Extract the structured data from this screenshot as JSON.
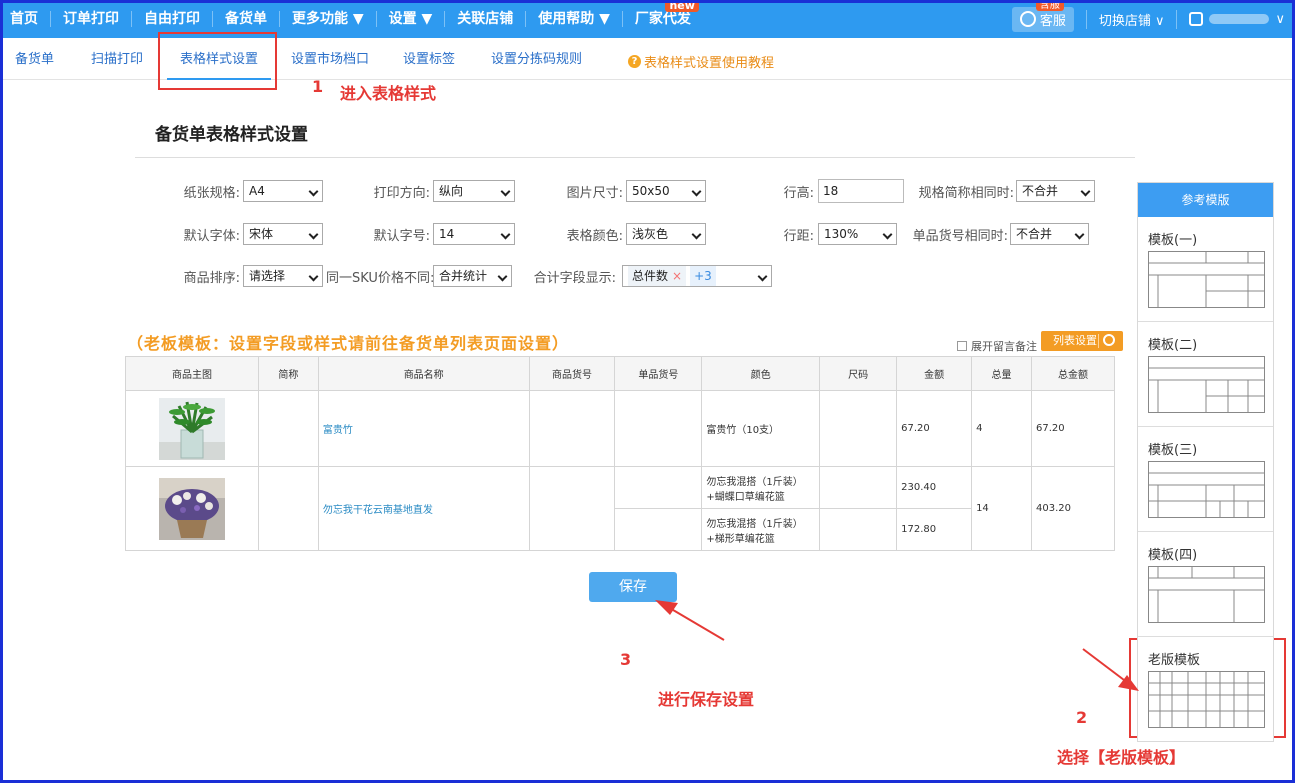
{
  "topnav": {
    "items": [
      {
        "label": "首页"
      },
      {
        "label": "订单打印"
      },
      {
        "label": "自由打印"
      },
      {
        "label": "备货单"
      },
      {
        "label": "更多功能 ▼"
      },
      {
        "label": "设置 ▼"
      },
      {
        "label": "关联店铺"
      },
      {
        "label": "使用帮助 ▼"
      },
      {
        "label": "厂家代发",
        "badge": "new"
      }
    ],
    "kefu": "客服",
    "kefu_badge": "含服",
    "switch_shop": "切换店铺 ∨"
  },
  "subnav": {
    "tabs": [
      "备货单",
      "扫描打印",
      "表格样式设置",
      "设置市场档口",
      "设置标签",
      "设置分拣码规则"
    ],
    "help": "表格样式设置使用教程",
    "help_icon": "?"
  },
  "annotations": {
    "n1": "1",
    "t1": "进入表格样式",
    "n2": "2",
    "t2": "选择【老版模板】",
    "n3": "3",
    "t3": "进行保存设置"
  },
  "page_title": "备货单表格样式设置",
  "form": {
    "paper_label": "纸张规格:",
    "paper": "A4",
    "direction_label": "打印方向:",
    "direction": "纵向",
    "imgsize_label": "图片尺寸:",
    "imgsize": "50x50",
    "rowheight_label": "行高:",
    "rowheight": "18",
    "merge_spec_label": "规格简称相同时:",
    "merge_spec": "不合并",
    "font_label": "默认字体:",
    "font": "宋体",
    "fontsize_label": "默认字号:",
    "fontsize": "14",
    "tablecolor_label": "表格颜色:",
    "tablecolor": "浅灰色",
    "linespace_label": "行距:",
    "linespace": "130%",
    "merge_sku_label": "单品货号相同时:",
    "merge_sku": "不合并",
    "sort_label": "商品排序:",
    "sort": "请选择",
    "sku_price_label": "同一SKU价格不同:",
    "sku_price": "合并统计",
    "sum_label": "合计字段显示:",
    "sum_tag": "总件数",
    "sum_tag_x": "×",
    "sum_more": "+3"
  },
  "notice": "（老板模板：设置字段或样式请前往备货单列表页面设置）",
  "expand_remark": "展开留言备注",
  "list_settings": "列表设置",
  "table": {
    "headers": [
      "商品主图",
      "简称",
      "商品名称",
      "商品货号",
      "单品货号",
      "颜色",
      "尺码",
      "金额",
      "总量",
      "总金额"
    ],
    "row1": {
      "name": "富贵竹",
      "color": "富贵竹（10支）",
      "amount": "67.20",
      "qty": "4",
      "total": "67.20"
    },
    "row2": {
      "name": "勿忘我干花云南基地直发",
      "color1": "勿忘我混搭（1斤装）+蝴蝶口草编花篮",
      "amount1": "230.40",
      "color2": "勿忘我混搭（1斤装）+梯形草编花篮",
      "amount2": "172.80",
      "qty": "14",
      "total": "403.20"
    }
  },
  "save_button": "保存",
  "side": {
    "title": "参考模版",
    "templates": [
      "模板(一)",
      "模板(二)",
      "模板(三)",
      "模板(四)",
      "老版模板"
    ]
  },
  "colors": {
    "primary": "#2e9af0",
    "accent": "#f39c24",
    "annotation": "#e53935",
    "link": "#2a8bc4",
    "frame": "#1a2fd6"
  }
}
